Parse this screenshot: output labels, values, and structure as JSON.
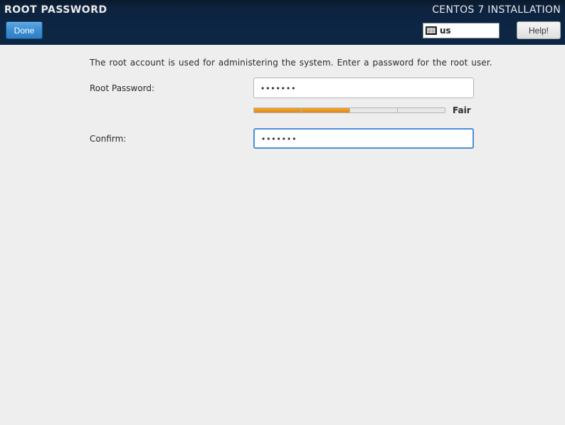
{
  "header": {
    "title": "ROOT PASSWORD",
    "subtitle": "CENTOS 7 INSTALLATION",
    "done_label": "Done",
    "help_label": "Help!",
    "keyboard_layout": "us"
  },
  "form": {
    "description": "The root account is used for administering the system.   Enter a password for the root user.",
    "password_label": "Root Password:",
    "password_value": "•••••••",
    "confirm_label": "Confirm:",
    "confirm_value": "•••••••",
    "strength_label": "Fair",
    "strength_segments_filled": 2,
    "strength_segments_total": 4
  }
}
